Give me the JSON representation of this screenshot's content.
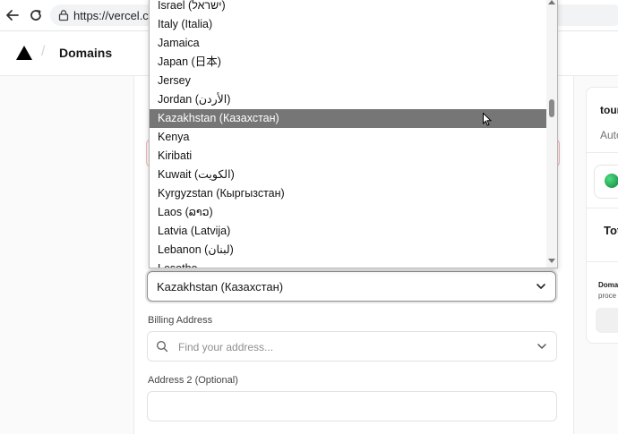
{
  "browser": {
    "url": "https://vercel.com"
  },
  "header": {
    "title": "Domains"
  },
  "dropdown": {
    "options": [
      "Israel (ישראל)",
      "Italy (Italia)",
      "Jamaica",
      "Japan (日本)",
      "Jersey",
      "Jordan (الأردن)",
      "Kazakhstan (Казахстан)",
      "Kenya",
      "Kiribati",
      "Kuwait (الكويت)",
      "Kyrgyzstan (Кыргызстан)",
      "Laos (ລາວ)",
      "Latvia (Latvija)",
      "Lebanon (لبنان)",
      "Lesotho"
    ],
    "selected_index": 6
  },
  "country_select": {
    "value": "Kazakhstan (Казахстан)"
  },
  "billing": {
    "label": "Billing Address",
    "placeholder": "Find your address..."
  },
  "address2": {
    "label": "Address 2 (Optional)"
  },
  "side": {
    "domain": "tour",
    "auto": "Auto",
    "total": "Tot",
    "note_title": "Doma",
    "note_text": "proce"
  }
}
